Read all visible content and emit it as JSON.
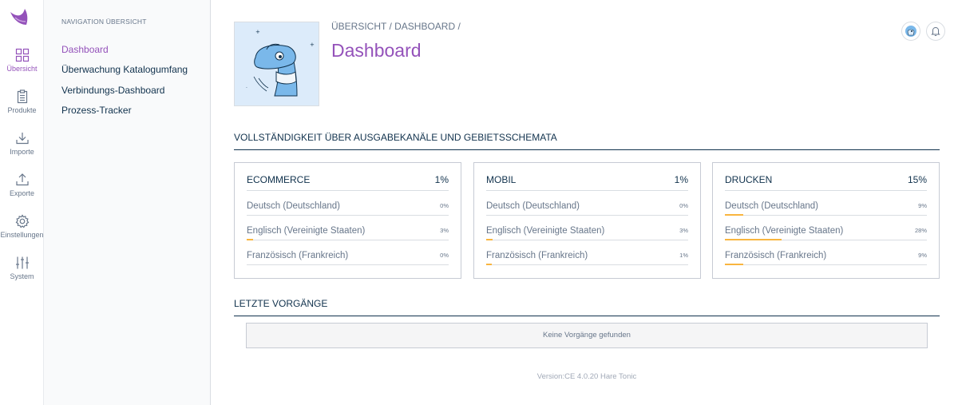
{
  "colors": {
    "accent": "#9452ba",
    "text": "#11324d",
    "muted": "#67768a",
    "progress": "#f9b53f"
  },
  "rail": [
    {
      "icon": "dashboard-grid-icon",
      "label": "Übersicht",
      "active": true
    },
    {
      "icon": "clipboard-icon",
      "label": "Produkte"
    },
    {
      "icon": "import-icon",
      "label": "Importe"
    },
    {
      "icon": "export-icon",
      "label": "Exporte"
    },
    {
      "icon": "gear-icon",
      "label": "Einstellungen"
    },
    {
      "icon": "sliders-icon",
      "label": "System"
    }
  ],
  "nav": {
    "title": "NAVIGATION ÜBERSICHT",
    "items": [
      {
        "label": "Dashboard",
        "active": true
      },
      {
        "label": "Überwachung Katalogumfang"
      },
      {
        "label": "Verbindungs-Dashboard"
      },
      {
        "label": "Prozess-Tracker"
      }
    ]
  },
  "header": {
    "breadcrumb": "ÜBERSICHT / DASHBOARD /",
    "title": "Dashboard"
  },
  "completeness": {
    "title": "VOLLSTÄNDIGKEIT ÜBER AUSGABEKANÄLE UND GEBIETSSCHEMATA",
    "channels": [
      {
        "name": "ECOMMERCE",
        "percent": "1%",
        "locales": [
          {
            "label": "Deutsch (Deutschland)",
            "value": "0%",
            "fraction": 0
          },
          {
            "label": "Englisch (Vereinigte Staaten)",
            "value": "3%",
            "fraction": 0.03
          },
          {
            "label": "Französisch (Frankreich)",
            "value": "0%",
            "fraction": 0
          }
        ]
      },
      {
        "name": "MOBIL",
        "percent": "1%",
        "locales": [
          {
            "label": "Deutsch (Deutschland)",
            "value": "0%",
            "fraction": 0
          },
          {
            "label": "Englisch (Vereinigte Staaten)",
            "value": "3%",
            "fraction": 0.03
          },
          {
            "label": "Französisch (Frankreich)",
            "value": "1%",
            "fraction": 0.01
          }
        ]
      },
      {
        "name": "DRUCKEN",
        "percent": "15%",
        "locales": [
          {
            "label": "Deutsch (Deutschland)",
            "value": "9%",
            "fraction": 0.09
          },
          {
            "label": "Englisch (Vereinigte Staaten)",
            "value": "28%",
            "fraction": 0.28
          },
          {
            "label": "Französisch (Frankreich)",
            "value": "9%",
            "fraction": 0.09
          }
        ]
      }
    ]
  },
  "activity": {
    "title": "LETZTE VORGÄNGE",
    "empty": "Keine Vorgänge gefunden"
  },
  "footer": {
    "version": "Version:CE 4.0.20 Hare Tonic"
  }
}
